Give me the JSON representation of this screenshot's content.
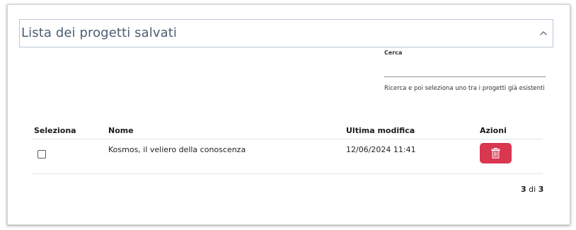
{
  "panel": {
    "title": "Lista dei progetti salvati",
    "collapse_icon": "chevron-up-icon"
  },
  "search": {
    "label": "Cerca",
    "value": "",
    "hint": "Ricerca e poi seleziona uno tra i progetti già esistenti"
  },
  "table": {
    "columns": {
      "select": "Seleziona",
      "name": "Nome",
      "modified": "Ultima modifica",
      "actions": "Azioni"
    },
    "rows": [
      {
        "checked": false,
        "name": "Kosmos, il veliero della conoscenza",
        "modified": "12/06/2024 11:41",
        "action_icon": "trash-icon"
      }
    ]
  },
  "pagination": {
    "current": "3",
    "separator": "di",
    "total": "3"
  },
  "colors": {
    "accent_title": "#4c5d73",
    "delete_button": "#d9364f",
    "header_border": "#b9c6d6"
  }
}
